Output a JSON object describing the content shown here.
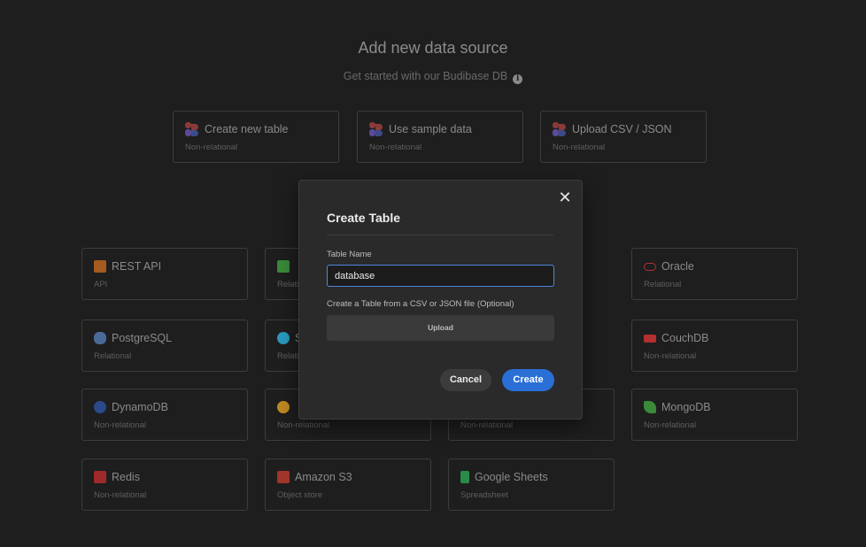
{
  "header": {
    "title": "Add new data source",
    "subtitle": "Get started with our Budibase DB"
  },
  "top_cards": [
    {
      "title": "Create new table",
      "subtitle": "Non-relational",
      "icon": "budibase-icon"
    },
    {
      "title": "Use sample data",
      "subtitle": "Non-relational",
      "icon": "budibase-icon"
    },
    {
      "title": "Upload CSV / JSON",
      "subtitle": "Non-relational",
      "icon": "budibase-icon"
    }
  ],
  "sources": [
    {
      "title": "REST API",
      "subtitle": "API",
      "icon": "rest-api-icon",
      "color": "#a35b1f"
    },
    {
      "title": "",
      "subtitle": "Relati",
      "icon": "sqlserver-icon",
      "color": "#3a8a3a"
    },
    {
      "title": "Oracle",
      "subtitle": "Relational",
      "icon": "oracle-icon",
      "color": "#b53030"
    },
    {
      "title": "PostgreSQL",
      "subtitle": "Relational",
      "icon": "postgresql-icon",
      "color": "#4a6a9a"
    },
    {
      "title": "S",
      "subtitle": "Relati",
      "icon": "snowflake-icon",
      "color": "#2a9ac0"
    },
    {
      "title": "CouchDB",
      "subtitle": "Non-relational",
      "icon": "couchdb-icon",
      "color": "#b53030"
    },
    {
      "title": "DynamoDB",
      "subtitle": "Non-relational",
      "icon": "dynamodb-icon",
      "color": "#2a4a8a"
    },
    {
      "title": "",
      "subtitle": "Non-relational",
      "icon": "firebase-icon",
      "color": "#c08a20"
    },
    {
      "title": "",
      "subtitle": "Non-relational",
      "icon": "hidden-icon",
      "color": "#1e1e1e"
    },
    {
      "title": "MongoDB",
      "subtitle": "Non-relational",
      "icon": "mongodb-icon",
      "color": "#3a8a3a"
    },
    {
      "title": "Redis",
      "subtitle": "Non-relational",
      "icon": "redis-icon",
      "color": "#a02a2a"
    },
    {
      "title": "Amazon S3",
      "subtitle": "Object store",
      "icon": "amazon-s3-icon",
      "color": "#a0352a"
    },
    {
      "title": "Google Sheets",
      "subtitle": "Spreadsheet",
      "icon": "google-sheets-icon",
      "color": "#2a8a4a"
    }
  ],
  "modal": {
    "title": "Create Table",
    "table_name_label": "Table Name",
    "table_name_value": "database",
    "upload_label": "Create a Table from a CSV or JSON file (Optional)",
    "upload_button": "Upload",
    "cancel_button": "Cancel",
    "create_button": "Create",
    "close_icon": "close-icon"
  },
  "colors": {
    "background": "#1e1e1e",
    "modal": "#2a2a2a",
    "accent": "#2a6fd6",
    "input_focus": "#4e88e0"
  }
}
